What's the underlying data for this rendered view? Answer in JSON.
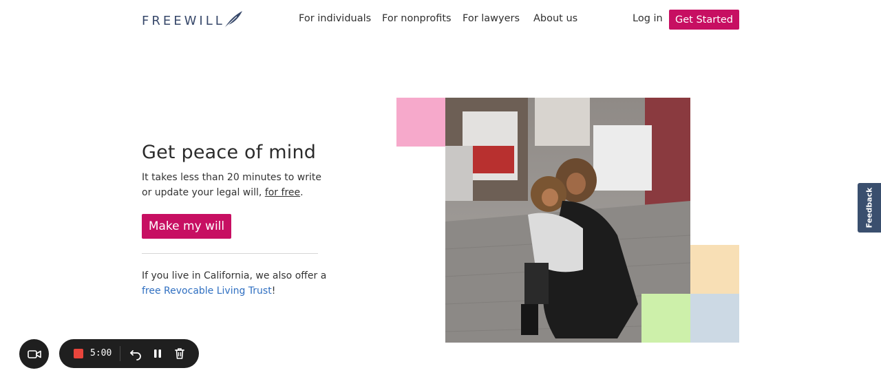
{
  "header": {
    "logo_text": "FREEWILL",
    "nav": {
      "individuals": "For individuals",
      "nonprofits": "For nonprofits",
      "lawyers": "For lawyers",
      "about": "About us"
    },
    "login": "Log in",
    "get_started": "Get Started"
  },
  "hero": {
    "title": "Get peace of mind",
    "subtitle_pre": "It takes less than 20 minutes to write or update your legal will, ",
    "subtitle_link": "for free",
    "subtitle_post": ".",
    "cta": "Make my will",
    "ca_pre": "If you live in California, we also offer a ",
    "ca_link": "free Revocable Living Trust",
    "ca_post": "!"
  },
  "feedback": {
    "label": "Feedback"
  },
  "recorder": {
    "time": "5:00"
  },
  "colors": {
    "brand": "#c70f62",
    "link": "#2f6fc1",
    "logo": "#37486a",
    "tile_pink": "#f6a9cb",
    "tile_peach": "#f8dfb5",
    "tile_green": "#cdf0aa",
    "tile_blue": "#ccd9e4"
  },
  "icons": {
    "logo_feather": "feather-icon",
    "camera": "video-camera-icon",
    "stop": "stop-record-icon",
    "undo": "undo-icon",
    "pause": "pause-icon",
    "delete": "trash-icon"
  }
}
